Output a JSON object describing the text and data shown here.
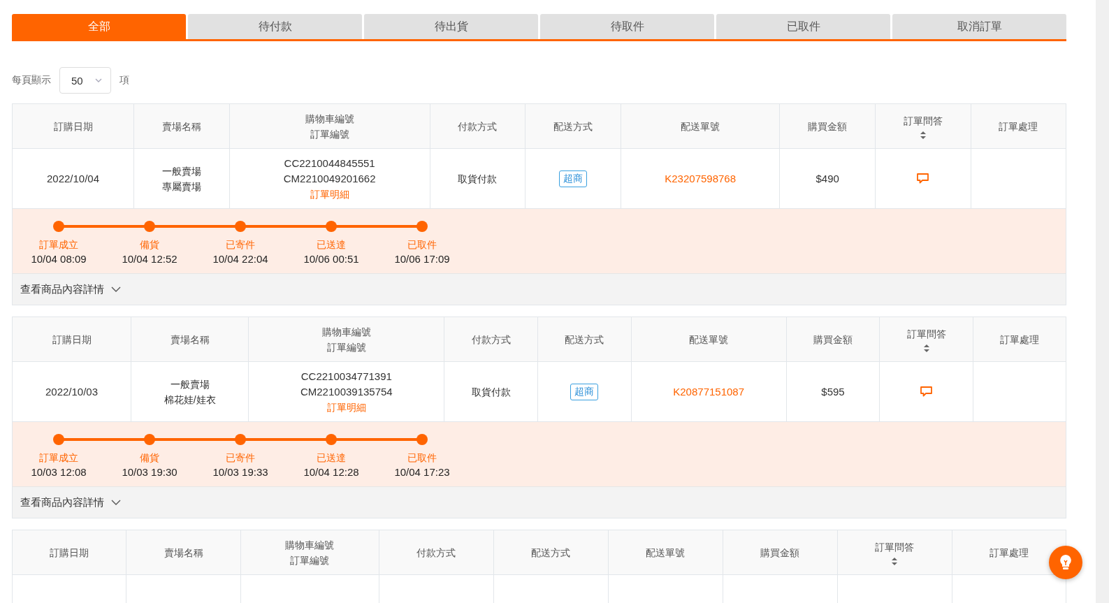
{
  "tabs": [
    {
      "label": "全部",
      "selected": true
    },
    {
      "label": "待付款",
      "selected": false
    },
    {
      "label": "待出貨",
      "selected": false
    },
    {
      "label": "待取件",
      "selected": false
    },
    {
      "label": "已取件",
      "selected": false
    },
    {
      "label": "取消訂單",
      "selected": false
    }
  ],
  "page_size": {
    "label": "每頁顯示",
    "value": "50",
    "suffix": "項"
  },
  "orders": [
    {
      "columns": [
        {
          "lines": [
            "訂購日期"
          ]
        },
        {
          "lines": [
            "賣場名稱"
          ]
        },
        {
          "lines": [
            "購物車編號",
            "訂單編號"
          ]
        },
        {
          "lines": [
            "付款方式"
          ]
        },
        {
          "lines": [
            "配送方式"
          ]
        },
        {
          "lines": [
            "配送單號"
          ]
        },
        {
          "lines": [
            "購買金額"
          ]
        },
        {
          "lines": [
            "訂單問答"
          ],
          "sortable": true
        },
        {
          "lines": [
            "訂單處理"
          ]
        }
      ],
      "row": {
        "date": "2022/10/04",
        "store": [
          "一般賣場",
          "專屬賣場"
        ],
        "cart_no": "CC2210044845551",
        "order_no": "CM2210049201662",
        "detail_link": "訂單明細",
        "payment": "取貨付款",
        "shipping": "超商",
        "tracking_no": "K23207598768",
        "amount": "$490"
      },
      "timeline": [
        {
          "label": "訂單成立",
          "time": "10/04 08:09",
          "done": true
        },
        {
          "label": "備貨",
          "time": "10/04 12:52",
          "done": true
        },
        {
          "label": "已寄件",
          "time": "10/04 22:04",
          "done": true
        },
        {
          "label": "已送達",
          "time": "10/06 00:51",
          "done": true
        },
        {
          "label": "已取件",
          "time": "10/06 17:09",
          "done": true
        }
      ],
      "details_toggle": "查看商品內容詳情"
    },
    {
      "columns": [
        {
          "lines": [
            "訂購日期"
          ]
        },
        {
          "lines": [
            "賣場名稱"
          ]
        },
        {
          "lines": [
            "購物車編號",
            "訂單編號"
          ]
        },
        {
          "lines": [
            "付款方式"
          ]
        },
        {
          "lines": [
            "配送方式"
          ]
        },
        {
          "lines": [
            "配送單號"
          ]
        },
        {
          "lines": [
            "購買金額"
          ]
        },
        {
          "lines": [
            "訂單問答"
          ],
          "sortable": true
        },
        {
          "lines": [
            "訂單處理"
          ]
        }
      ],
      "row": {
        "date": "2022/10/03",
        "store": [
          "一般賣場",
          "棉花娃/娃衣"
        ],
        "cart_no": "CC2210034771391",
        "order_no": "CM2210039135754",
        "detail_link": "訂單明細",
        "payment": "取貨付款",
        "shipping": "超商",
        "tracking_no": "K20877151087",
        "amount": "$595"
      },
      "timeline": [
        {
          "label": "訂單成立",
          "time": "10/03 12:08",
          "done": true
        },
        {
          "label": "備貨",
          "time": "10/03 19:30",
          "done": true
        },
        {
          "label": "已寄件",
          "time": "10/03 19:33",
          "done": true
        },
        {
          "label": "已送達",
          "time": "10/04 12:28",
          "done": true
        },
        {
          "label": "已取件",
          "time": "10/04 17:23",
          "done": true
        }
      ],
      "details_toggle": "查看商品內容詳情"
    },
    {
      "columns": [
        {
          "lines": [
            "訂購日期"
          ]
        },
        {
          "lines": [
            "賣場名稱"
          ]
        },
        {
          "lines": [
            "購物車編號",
            "訂單編號"
          ]
        },
        {
          "lines": [
            "付款方式"
          ]
        },
        {
          "lines": [
            "配送方式"
          ]
        },
        {
          "lines": [
            "配送單號"
          ]
        },
        {
          "lines": [
            "購買金額"
          ]
        },
        {
          "lines": [
            "訂單問答"
          ],
          "sortable": true
        },
        {
          "lines": [
            "訂單處理"
          ]
        }
      ]
    }
  ]
}
